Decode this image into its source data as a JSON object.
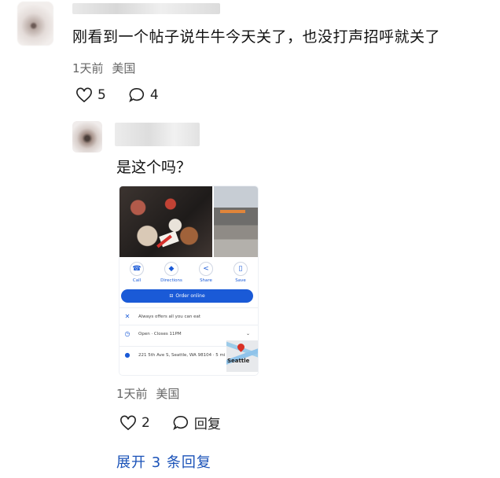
{
  "top_comment": {
    "text": "刚看到一个帖子说牛牛今天关了，也没打声招呼就关了",
    "time": "1天前",
    "location": "美国",
    "like_count": "5",
    "comment_count": "4"
  },
  "reply": {
    "text": "是这个吗？",
    "time": "1天前",
    "location": "美国",
    "like_count": "2",
    "reply_label": "回复",
    "screenshot": {
      "icons": [
        {
          "label": "Call",
          "glyph": "☎"
        },
        {
          "label": "Directions",
          "glyph": "◆"
        },
        {
          "label": "Share",
          "glyph": "<"
        },
        {
          "label": "Save",
          "glyph": "▯"
        }
      ],
      "order_label": "Order online",
      "info_line_1": "Always offers all you can eat",
      "info_line_2": "Open · Closes 11PM",
      "info_line_3": "221 5th Ave S, Seattle, WA 98104 · 5 mi",
      "map_label": "Seattle"
    }
  },
  "expand_label": "展开 3 条回复",
  "colors": {
    "link": "#1a52b8",
    "meta": "#666666",
    "accent": "#1a5ad7"
  }
}
